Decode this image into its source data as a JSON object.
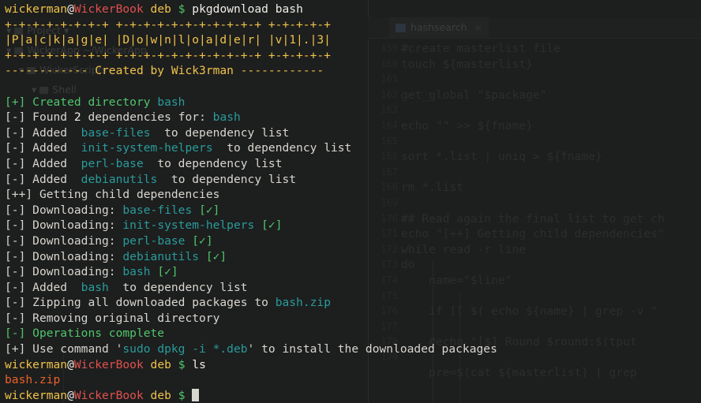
{
  "terminal": {
    "background_color": "#1f2020",
    "palette": {
      "white": "#f0eee8",
      "yellow": "#efc349",
      "red": "#e0514f",
      "green": "#4fc66c",
      "teal": "#2a9b9b",
      "orange": "#e8622c"
    },
    "prompt": {
      "user": "wickerman",
      "at": "@",
      "host": "WickerBook",
      "dir": "deb",
      "symbol": "$"
    },
    "commands": {
      "first": "pkgdownload bash",
      "second": "ls",
      "third": ""
    },
    "banner": {
      "rule_top": "+-+-+-+-+-+-+-+ +-+-+-+-+-+-+-+-+-+-+ +-+-+-+-+",
      "title": "|P|a|c|k|a|g|e| |D|o|w|n|l|o|a|d|e|r| |v|1|.|3|",
      "rule_bottom": "+-+-+-+-+-+-+-+ +-+-+-+-+-+-+-+-+-+-+ +-+-+-+-+",
      "credit_left_dashes": "------------",
      "credit_text": "Created by Wick3rman",
      "credit_right_dashes": "------------"
    },
    "output": {
      "created_directory": {
        "tag": "[+]",
        "text": "Created directory",
        "target": "bash"
      },
      "found_deps": {
        "tag": "[-]",
        "prefix": "Found",
        "count": "2",
        "middle": "dependencies for:",
        "package": "bash"
      },
      "added_label": "Added",
      "added_suffix": "to dependency list",
      "added_packages": [
        "base-files",
        "init-system-helpers",
        "perl-base",
        "debianutils"
      ],
      "child_deps": {
        "tag": "[++]",
        "text": "Getting child dependencies"
      },
      "downloading_label": "Downloading:",
      "downloads": [
        {
          "package": "base-files",
          "status": "[✓]"
        },
        {
          "package": "init-system-helpers",
          "status": "[✓]"
        },
        {
          "package": "perl-base",
          "status": "[✓]"
        },
        {
          "package": "debianutils",
          "status": "[✓]"
        },
        {
          "package": "bash",
          "status": "[✓]"
        }
      ],
      "added_bash": {
        "tag": "[-]",
        "label": "Added",
        "package": "bash",
        "suffix": "to dependency list"
      },
      "zipping": {
        "tag": "[-]",
        "text": "Zipping all downloaded packages to",
        "archive": "bash.zip"
      },
      "removing": {
        "tag": "[-]",
        "text": "Removing original directory"
      },
      "complete": {
        "tag": "[-]",
        "text": "Operations complete"
      },
      "install_hint": {
        "tag": "[+]",
        "before": "Use command '",
        "command": "sudo dpkg -i *.deb",
        "after": "' to install the downloaded packages"
      },
      "ls_result": "bash.zip"
    }
  },
  "background_window": {
    "tab_label": "hashsearch",
    "tab_close": "×",
    "project_tree": [
      "Project",
      "WickerApp   ~/WickerApp",
      "WickerScripts",
      "Shell"
    ],
    "code_lines": [
      "#create masterlist file",
      "touch ${masterlist}",
      "",
      "get_global \"$package\"",
      "",
      "echo \"\" >> ${fname}",
      "",
      "sort *.list | uniq > ${fname}",
      "",
      "rm *.list",
      "",
      "## Read again the final list to get ch",
      "echo \"[++] Getting child dependencies\"",
      "while read -r line",
      "do",
      "    name=\"$line\"",
      "",
      "    if [[ $( echo ${name} | grep -v \"",
      "",
      "    #echo \"[$] Round $round:$(tput",
      "",
      "    pre=$(cat ${masterlist} | grep"
    ],
    "gutter_numbers": [
      "159",
      "160",
      "161",
      "162",
      "163",
      "164",
      "165",
      "166",
      "167",
      "168",
      "169",
      "170",
      "171",
      "172",
      "173",
      "174",
      "175",
      "176",
      "177",
      "178",
      "179"
    ]
  }
}
